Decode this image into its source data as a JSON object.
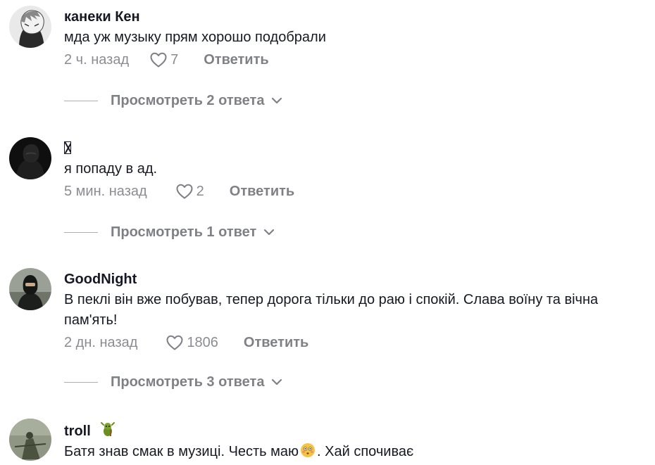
{
  "comments": [
    {
      "author": "канеки Кен",
      "text": "мда уж музыку прям хорошо подобрали",
      "time": "2 ч. назад",
      "likes": "7",
      "reply_label": "Ответить",
      "view_replies": "Просмотреть 2 ответа"
    },
    {
      "author": "",
      "text": "я попаду в ад.",
      "time": "5 мин. назад",
      "likes": "2",
      "reply_label": "Ответить",
      "view_replies": "Просмотреть 1 ответ"
    },
    {
      "author": "GoodNight",
      "text": "В пеклі він вже побував, тепер дорога тільки до раю і спокій. Слава воїну та вічна пам'ять!",
      "time": "2 дн. назад",
      "likes": "1806",
      "reply_label": "Ответить",
      "view_replies": "Просмотреть 3 ответа"
    },
    {
      "author": "troll",
      "text_before": "Батя знав смак в музиці. Честь маю",
      "text_after": ". Хай спочиває"
    }
  ],
  "icons": {
    "like": "heart-outline-icon",
    "expand": "chevron-down-icon",
    "author_badge": "troll-emoji-icon",
    "inline_emoji": "flushed-face-emoji-icon"
  },
  "colors": {
    "text_primary": "#161823",
    "text_secondary": "rgba(22,24,35,0.5)"
  }
}
